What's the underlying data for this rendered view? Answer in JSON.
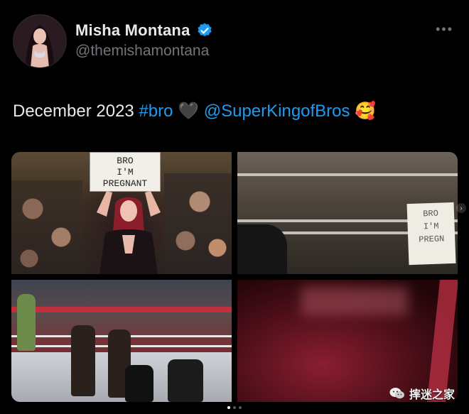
{
  "author": {
    "display_name": "Misha Montana",
    "handle": "@themishamontana",
    "verified": true,
    "avatar_icon": "profile-photo"
  },
  "menu": {
    "more_label": "•••"
  },
  "post": {
    "text_prefix": "December 2023 ",
    "hashtag": "#bro",
    "heart_emoji": "🖤",
    "mention": "@SuperKingofBros",
    "face_emoji": "🥰"
  },
  "media": [
    {
      "alt_icon": "photo",
      "sign_text": "BRO\nI'M\nPREGNANT"
    },
    {
      "alt_icon": "photo",
      "sign_text": "BRO\nI'M\nPREGN"
    },
    {
      "alt_icon": "photo"
    },
    {
      "alt_icon": "photo"
    }
  ],
  "pagination": {
    "total": 3,
    "active": 0
  },
  "watermark": {
    "text": "摔迷之家",
    "icon": "wechat-icon"
  },
  "colors": {
    "background": "#000000",
    "text": "#e7e9ea",
    "muted": "#71767b",
    "link": "#1d9bf0",
    "verified": "#1d9bf0"
  }
}
